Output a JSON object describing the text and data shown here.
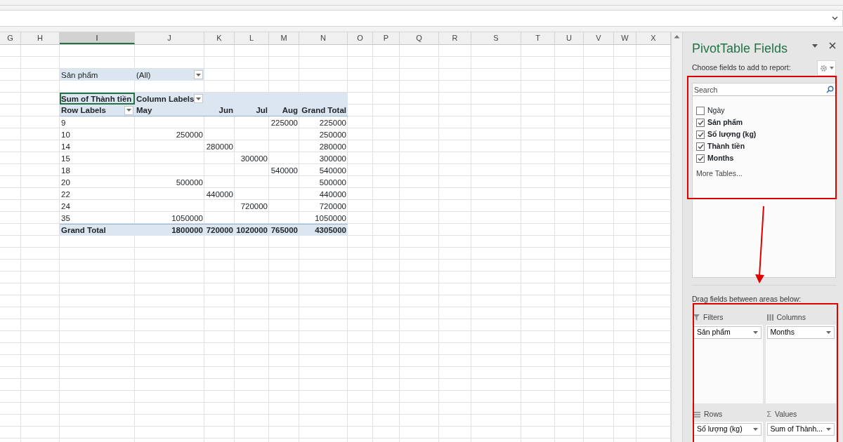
{
  "column_headers": [
    {
      "label": "G",
      "selected": false
    },
    {
      "label": "H",
      "selected": false
    },
    {
      "label": "I",
      "selected": true
    },
    {
      "label": "J",
      "selected": false
    },
    {
      "label": "K",
      "selected": false
    },
    {
      "label": "L",
      "selected": false
    },
    {
      "label": "M",
      "selected": false
    },
    {
      "label": "N",
      "selected": false
    },
    {
      "label": "O",
      "selected": false
    },
    {
      "label": "P",
      "selected": false
    },
    {
      "label": "Q",
      "selected": false
    },
    {
      "label": "R",
      "selected": false
    },
    {
      "label": "S",
      "selected": false
    },
    {
      "label": "T",
      "selected": false
    },
    {
      "label": "U",
      "selected": false
    },
    {
      "label": "V",
      "selected": false
    },
    {
      "label": "W",
      "selected": false
    },
    {
      "label": "X",
      "selected": false
    }
  ],
  "pivot": {
    "filter": {
      "label": "Sản phẩm",
      "value": "(All)"
    },
    "value_label": "Sum of Thành tiền",
    "column_labels": "Column Labels",
    "row_labels": "Row Labels",
    "columns": {
      "may": "May",
      "jun": "Jun",
      "jul": "Jul",
      "aug": "Aug",
      "grand_total": "Grand Total"
    },
    "rows": [
      {
        "label": "9",
        "aug": "225000",
        "grand_total": "225000"
      },
      {
        "label": "10",
        "may": "250000",
        "grand_total": "250000"
      },
      {
        "label": "14",
        "jun": "280000",
        "grand_total": "280000"
      },
      {
        "label": "15",
        "jul": "300000",
        "grand_total": "300000"
      },
      {
        "label": "18",
        "aug": "540000",
        "grand_total": "540000"
      },
      {
        "label": "20",
        "may": "500000",
        "grand_total": "500000"
      },
      {
        "label": "22",
        "jun": "440000",
        "grand_total": "440000"
      },
      {
        "label": "24",
        "jul": "720000",
        "grand_total": "720000"
      },
      {
        "label": "35",
        "may": "1050000",
        "grand_total": "1050000"
      }
    ],
    "grand_total": {
      "label": "Grand Total",
      "may": "1800000",
      "jun": "720000",
      "jul": "1020000",
      "aug": "765000",
      "grand_total": "4305000"
    }
  },
  "field_pane": {
    "title": "PivotTable Fields",
    "choose_label": "Choose fields to add to report:",
    "search": {
      "placeholder": "Search"
    },
    "fields": [
      {
        "label": "Ngày",
        "checked": false
      },
      {
        "label": "Sản phẩm",
        "checked": true
      },
      {
        "label": "Số lượng (kg)",
        "checked": true
      },
      {
        "label": "Thành tiền",
        "checked": true
      },
      {
        "label": "Months",
        "checked": true
      }
    ],
    "more_tables": "More Tables...",
    "drag_label": "Drag fields between areas below:",
    "areas": [
      {
        "kind": "filters",
        "title": "Filters",
        "items": [
          "Sản phẩm"
        ]
      },
      {
        "kind": "columns",
        "title": "Columns",
        "items": [
          "Months"
        ]
      },
      {
        "kind": "rows",
        "title": "Rows",
        "items": [
          "Số lượng (kg)"
        ]
      },
      {
        "kind": "values",
        "symbol": "Σ",
        "title": "Values",
        "items": [
          "Sum of Thành..."
        ]
      }
    ]
  }
}
